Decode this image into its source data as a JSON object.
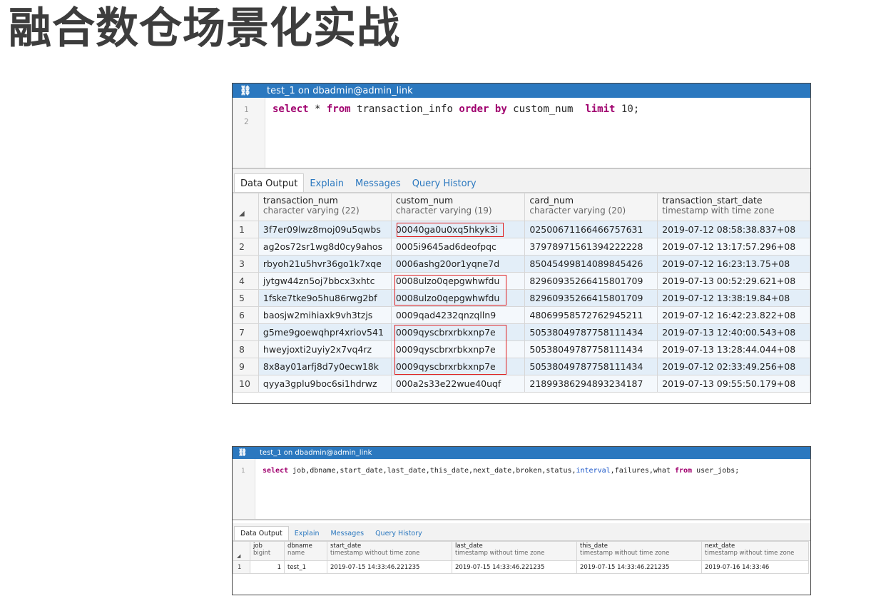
{
  "page_title": "融合数仓场景化实战",
  "panel1": {
    "title": "test_1 on dbadmin@admin_link",
    "line_numbers": [
      "1",
      "2"
    ],
    "sql": {
      "select": "select",
      "star": " * ",
      "from": "from",
      "table_part": " transaction_info ",
      "order_by": "order by",
      "col_part": " custom_num  ",
      "limit": "limit",
      "limit_value": " 10",
      "semicolon": ";"
    },
    "tabs": [
      "Data Output",
      "Explain",
      "Messages",
      "Query History"
    ],
    "columns": [
      {
        "name": "transaction_num",
        "type": "character varying (22)"
      },
      {
        "name": "custom_num",
        "type": "character varying (19)"
      },
      {
        "name": "card_num",
        "type": "character varying (20)"
      },
      {
        "name": "transaction_start_date",
        "type": "timestamp with time zone"
      }
    ],
    "rows": [
      [
        "1",
        "3f7er09lwz8moj09u5qwbs",
        "00040ga0u0xq5hkyk3i",
        "02500671166466757631",
        "2019-07-12 08:58:38.837+08"
      ],
      [
        "2",
        "ag2os72sr1wg8d0cy9ahos",
        "0005i9645ad6deofpqc",
        "37978971561394222228",
        "2019-07-12 13:17:57.296+08"
      ],
      [
        "3",
        "rbyoh21u5hvr36go1k7xqe",
        "0006ashg20or1yqne7d",
        "85045499814089845426",
        "2019-07-12 16:23:13.75+08"
      ],
      [
        "4",
        "jytgw44zn5oj7bbcx3xhtc",
        "0008ulzo0qepgwhwfdu",
        "82960935266415801709",
        "2019-07-13 00:52:29.621+08"
      ],
      [
        "5",
        "1fske7tke9o5hu86rwg2bf",
        "0008ulzo0qepgwhwfdu",
        "82960935266415801709",
        "2019-07-12 13:38:19.84+08"
      ],
      [
        "6",
        "baosjw2mihiaxk9vh3tzjs",
        "0009qad4232qnzqlln9",
        "48069958572762945211",
        "2019-07-12 16:42:23.822+08"
      ],
      [
        "7",
        "g5me9goewqhpr4xriov541",
        "0009qyscbrxrbkxnp7e",
        "50538049787758111434",
        "2019-07-13 12:40:00.543+08"
      ],
      [
        "8",
        "hweyjoxti2uyiy2x7vq4rz",
        "0009qyscbrxrbkxnp7e",
        "50538049787758111434",
        "2019-07-13 13:28:44.044+08"
      ],
      [
        "9",
        "8x8ay01arfj8d7y0ecw18k",
        "0009qyscbrxrbkxnp7e",
        "50538049787758111434",
        "2019-07-12 02:33:49.256+08"
      ],
      [
        "10",
        "qyya3gplu9boc6si1hdrwz",
        "000a2s33e22wue40uqf",
        "21899386294893234187",
        "2019-07-13 09:55:50.179+08"
      ]
    ]
  },
  "panel2": {
    "title": "test_1 on dbadmin@admin_link",
    "line_numbers": [
      "1"
    ],
    "sql": {
      "select": "select",
      "cols_a": " job,dbname,start_date,last_date,this_date,next_date,broken,status,",
      "interval": "interval",
      "cols_b": ",failures,what ",
      "from": "from",
      "table_part": " user_jobs;"
    },
    "tabs": [
      "Data Output",
      "Explain",
      "Messages",
      "Query History"
    ],
    "columns": [
      {
        "name": "job",
        "type": "bigint"
      },
      {
        "name": "dbname",
        "type": "name"
      },
      {
        "name": "start_date",
        "type": "timestamp without time zone"
      },
      {
        "name": "last_date",
        "type": "timestamp without time zone"
      },
      {
        "name": "this_date",
        "type": "timestamp without time zone"
      },
      {
        "name": "next_date",
        "type": "timestamp without time zone"
      }
    ],
    "rows": [
      [
        "1",
        "1",
        "test_1",
        "2019-07-15 14:33:46.221235",
        "2019-07-15 14:33:46.221235",
        "2019-07-15 14:33:46.221235",
        "2019-07-16 14:33:46"
      ]
    ]
  },
  "colors": {
    "titlebar": "#2b78bf",
    "highlight": "#e02020",
    "keyword": "#a0006e"
  }
}
